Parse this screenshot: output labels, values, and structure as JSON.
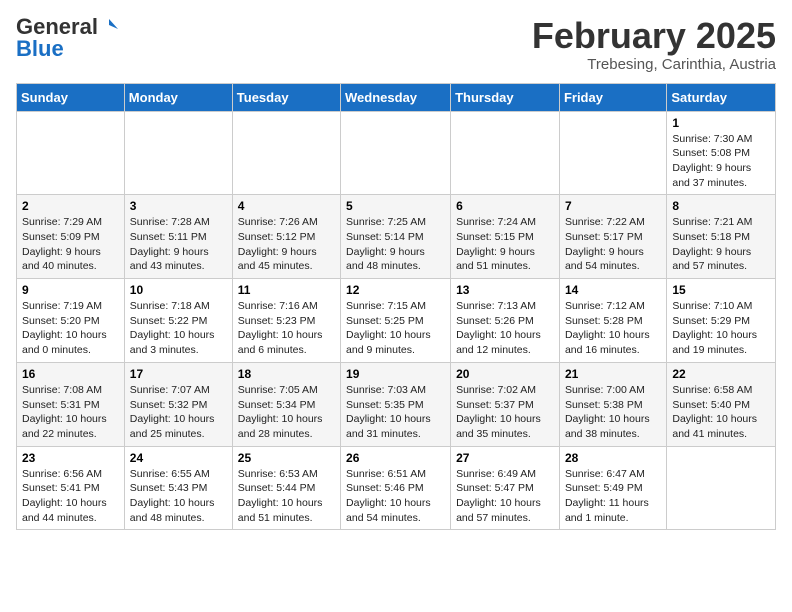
{
  "header": {
    "logo_general": "General",
    "logo_blue": "Blue",
    "month_title": "February 2025",
    "location": "Trebesing, Carinthia, Austria"
  },
  "days_of_week": [
    "Sunday",
    "Monday",
    "Tuesday",
    "Wednesday",
    "Thursday",
    "Friday",
    "Saturday"
  ],
  "weeks": [
    [
      {
        "day": "",
        "info": ""
      },
      {
        "day": "",
        "info": ""
      },
      {
        "day": "",
        "info": ""
      },
      {
        "day": "",
        "info": ""
      },
      {
        "day": "",
        "info": ""
      },
      {
        "day": "",
        "info": ""
      },
      {
        "day": "1",
        "info": "Sunrise: 7:30 AM\nSunset: 5:08 PM\nDaylight: 9 hours and 37 minutes."
      }
    ],
    [
      {
        "day": "2",
        "info": "Sunrise: 7:29 AM\nSunset: 5:09 PM\nDaylight: 9 hours and 40 minutes."
      },
      {
        "day": "3",
        "info": "Sunrise: 7:28 AM\nSunset: 5:11 PM\nDaylight: 9 hours and 43 minutes."
      },
      {
        "day": "4",
        "info": "Sunrise: 7:26 AM\nSunset: 5:12 PM\nDaylight: 9 hours and 45 minutes."
      },
      {
        "day": "5",
        "info": "Sunrise: 7:25 AM\nSunset: 5:14 PM\nDaylight: 9 hours and 48 minutes."
      },
      {
        "day": "6",
        "info": "Sunrise: 7:24 AM\nSunset: 5:15 PM\nDaylight: 9 hours and 51 minutes."
      },
      {
        "day": "7",
        "info": "Sunrise: 7:22 AM\nSunset: 5:17 PM\nDaylight: 9 hours and 54 minutes."
      },
      {
        "day": "8",
        "info": "Sunrise: 7:21 AM\nSunset: 5:18 PM\nDaylight: 9 hours and 57 minutes."
      }
    ],
    [
      {
        "day": "9",
        "info": "Sunrise: 7:19 AM\nSunset: 5:20 PM\nDaylight: 10 hours and 0 minutes."
      },
      {
        "day": "10",
        "info": "Sunrise: 7:18 AM\nSunset: 5:22 PM\nDaylight: 10 hours and 3 minutes."
      },
      {
        "day": "11",
        "info": "Sunrise: 7:16 AM\nSunset: 5:23 PM\nDaylight: 10 hours and 6 minutes."
      },
      {
        "day": "12",
        "info": "Sunrise: 7:15 AM\nSunset: 5:25 PM\nDaylight: 10 hours and 9 minutes."
      },
      {
        "day": "13",
        "info": "Sunrise: 7:13 AM\nSunset: 5:26 PM\nDaylight: 10 hours and 12 minutes."
      },
      {
        "day": "14",
        "info": "Sunrise: 7:12 AM\nSunset: 5:28 PM\nDaylight: 10 hours and 16 minutes."
      },
      {
        "day": "15",
        "info": "Sunrise: 7:10 AM\nSunset: 5:29 PM\nDaylight: 10 hours and 19 minutes."
      }
    ],
    [
      {
        "day": "16",
        "info": "Sunrise: 7:08 AM\nSunset: 5:31 PM\nDaylight: 10 hours and 22 minutes."
      },
      {
        "day": "17",
        "info": "Sunrise: 7:07 AM\nSunset: 5:32 PM\nDaylight: 10 hours and 25 minutes."
      },
      {
        "day": "18",
        "info": "Sunrise: 7:05 AM\nSunset: 5:34 PM\nDaylight: 10 hours and 28 minutes."
      },
      {
        "day": "19",
        "info": "Sunrise: 7:03 AM\nSunset: 5:35 PM\nDaylight: 10 hours and 31 minutes."
      },
      {
        "day": "20",
        "info": "Sunrise: 7:02 AM\nSunset: 5:37 PM\nDaylight: 10 hours and 35 minutes."
      },
      {
        "day": "21",
        "info": "Sunrise: 7:00 AM\nSunset: 5:38 PM\nDaylight: 10 hours and 38 minutes."
      },
      {
        "day": "22",
        "info": "Sunrise: 6:58 AM\nSunset: 5:40 PM\nDaylight: 10 hours and 41 minutes."
      }
    ],
    [
      {
        "day": "23",
        "info": "Sunrise: 6:56 AM\nSunset: 5:41 PM\nDaylight: 10 hours and 44 minutes."
      },
      {
        "day": "24",
        "info": "Sunrise: 6:55 AM\nSunset: 5:43 PM\nDaylight: 10 hours and 48 minutes."
      },
      {
        "day": "25",
        "info": "Sunrise: 6:53 AM\nSunset: 5:44 PM\nDaylight: 10 hours and 51 minutes."
      },
      {
        "day": "26",
        "info": "Sunrise: 6:51 AM\nSunset: 5:46 PM\nDaylight: 10 hours and 54 minutes."
      },
      {
        "day": "27",
        "info": "Sunrise: 6:49 AM\nSunset: 5:47 PM\nDaylight: 10 hours and 57 minutes."
      },
      {
        "day": "28",
        "info": "Sunrise: 6:47 AM\nSunset: 5:49 PM\nDaylight: 11 hours and 1 minute."
      },
      {
        "day": "",
        "info": ""
      }
    ]
  ]
}
